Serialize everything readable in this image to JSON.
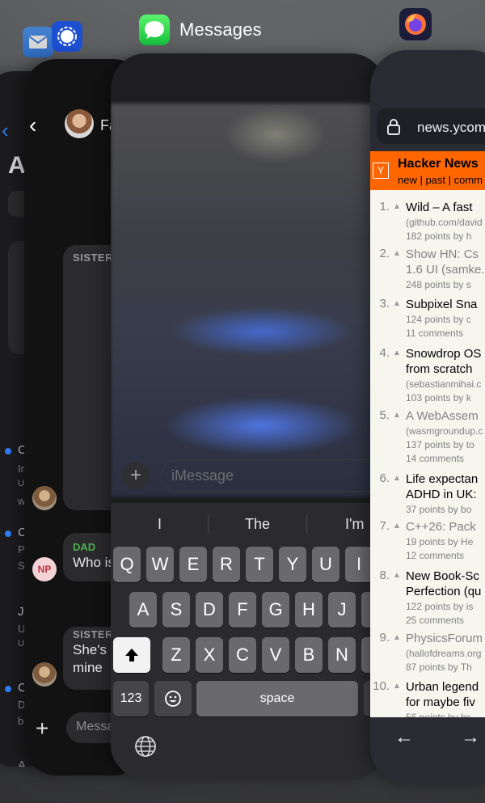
{
  "switcher": {
    "active_app_title": "Messages"
  },
  "mail": {
    "big_letter": "A",
    "rows": [
      {
        "initial": "C",
        "line2": "In",
        "line3": "U",
        "line4": "w"
      },
      {
        "initial": "C",
        "line2": "P",
        "line3": "S"
      },
      {
        "initial": "J",
        "line2": "U",
        "line3": "U"
      },
      {
        "initial": "C",
        "line2": "D",
        "line3": "b"
      }
    ],
    "bottom_letter": "A"
  },
  "signal": {
    "contact_name": "Fa",
    "sister_label_top": "SISTER",
    "dad_label": "DAD",
    "dad_message": "Who is",
    "np_initials": "NP",
    "sister_label_bottom": "SISTER",
    "sister_message_line1": "She's",
    "sister_message_line2": "mine",
    "input_placeholder": "Messa"
  },
  "messages": {
    "compose_placeholder": "iMessage",
    "predictions": [
      "I",
      "The",
      "I'm"
    ],
    "rows": [
      [
        "Q",
        "W",
        "E",
        "R",
        "T",
        "Y",
        "U",
        "I"
      ],
      [
        "A",
        "S",
        "D",
        "F",
        "G",
        "H",
        "J"
      ],
      [
        "Z",
        "X",
        "C",
        "V",
        "B",
        "N"
      ]
    ],
    "numbers_key": "123",
    "space_key": "space"
  },
  "firefox": {
    "url": "news.ycom",
    "hn": {
      "logo": "Y",
      "title": "Hacker News",
      "nav": "new | past | comm",
      "items": [
        {
          "rank": "1.",
          "lines": [
            "Wild – A fast"
          ],
          "sub": [
            "(github.com/david",
            "182 points by h"
          ],
          "visited": false
        },
        {
          "rank": "2.",
          "lines": [
            "Show HN: Cs",
            "1.6 UI (samke."
          ],
          "sub": [
            "248 points by s"
          ],
          "visited": true
        },
        {
          "rank": "3.",
          "lines": [
            "Subpixel Sna"
          ],
          "sub": [
            "124 points by c",
            "11 comments"
          ],
          "visited": false
        },
        {
          "rank": "4.",
          "lines": [
            "Snowdrop OS",
            "from scratch"
          ],
          "sub": [
            "(sebastianmihai.c",
            "103 points by k"
          ],
          "visited": false
        },
        {
          "rank": "5.",
          "lines": [
            "A WebAssem"
          ],
          "sub": [
            "(wasmgroundup.c",
            "137 points by to",
            "14 comments"
          ],
          "visited": true
        },
        {
          "rank": "6.",
          "lines": [
            "Life expectan",
            "ADHD in UK:"
          ],
          "sub": [
            "37 points by bo"
          ],
          "visited": false
        },
        {
          "rank": "7.",
          "lines": [
            "C++26: Pack"
          ],
          "sub": [
            "19 points by He",
            "12 comments"
          ],
          "visited": true
        },
        {
          "rank": "8.",
          "lines": [
            "New Book-Sc",
            "Perfection (qu"
          ],
          "sub": [
            "122 points by is",
            "25 comments"
          ],
          "visited": false
        },
        {
          "rank": "9.",
          "lines": [
            "PhysicsForum"
          ],
          "sub": [
            "(hallofdreams.org",
            "87 points by Th"
          ],
          "visited": true
        },
        {
          "rank": "10.",
          "lines": [
            "Urban legend",
            "for maybe fiv"
          ],
          "sub": [
            "56 points by hs"
          ],
          "visited": false
        }
      ]
    }
  }
}
